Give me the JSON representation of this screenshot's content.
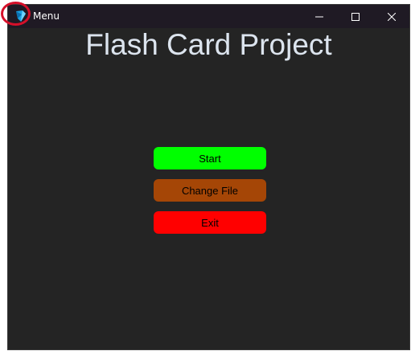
{
  "window": {
    "title": "Menu",
    "app_icon": "bookmark-app-icon",
    "controls": {
      "minimize": "minimize-icon",
      "maximize": "maximize-icon",
      "close": "close-icon"
    }
  },
  "main": {
    "heading": "Flash Card Project",
    "buttons": [
      {
        "label": "Start",
        "color": "#00ff00"
      },
      {
        "label": "Change File",
        "color": "#a54606"
      },
      {
        "label": "Exit",
        "color": "#ff0000"
      }
    ]
  },
  "annotation": {
    "color": "#d6102a"
  }
}
